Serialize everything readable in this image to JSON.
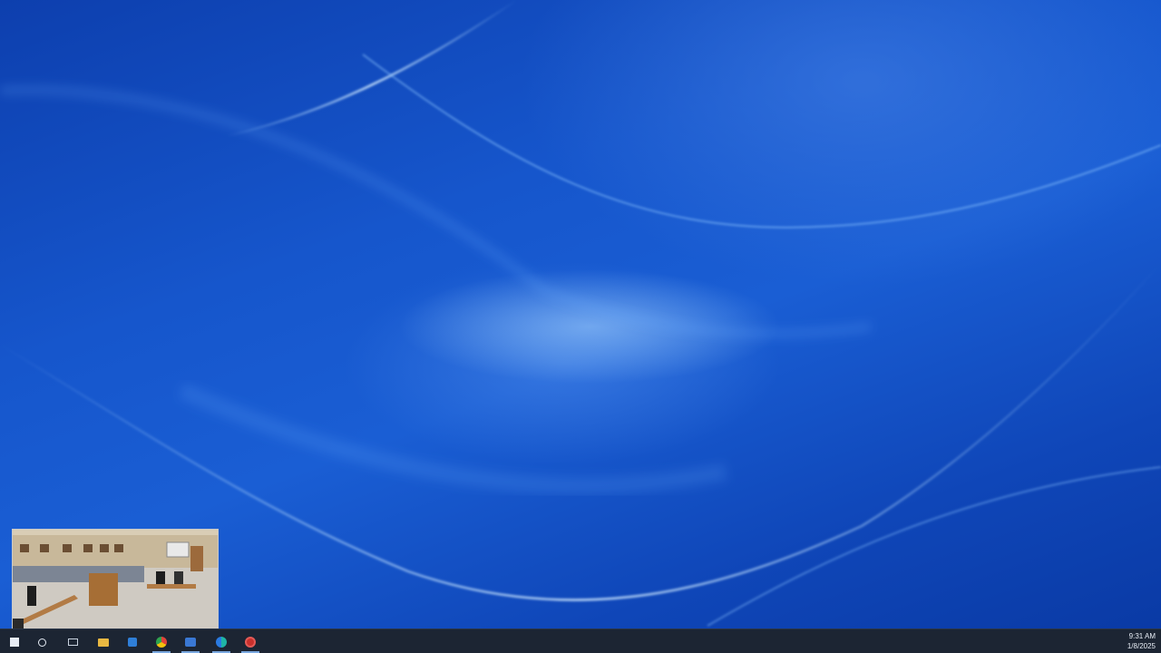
{
  "desktop": {
    "wallpaper": "blue-light-ribbon-wallpaper",
    "colors": {
      "base": "#1656cc",
      "dark": "#0a3aa5",
      "highlight": "#a9d4ff",
      "taskbar": "#1c2533"
    }
  },
  "video_overlay": {
    "description_icon": "meeting-room-video"
  },
  "taskbar": {
    "icons": [
      {
        "name": "start-icon",
        "active": false
      },
      {
        "name": "search-icon",
        "active": false
      },
      {
        "name": "task-view-icon",
        "active": false
      },
      {
        "name": "file-explorer-icon",
        "active": false
      },
      {
        "name": "chrome-icon",
        "active": true
      },
      {
        "name": "app-icon",
        "active": true
      },
      {
        "name": "edge-icon",
        "active": true
      },
      {
        "name": "red-app-icon",
        "active": true
      }
    ],
    "clock": {
      "time": "9:31 AM",
      "date": "1/8/2025"
    }
  }
}
